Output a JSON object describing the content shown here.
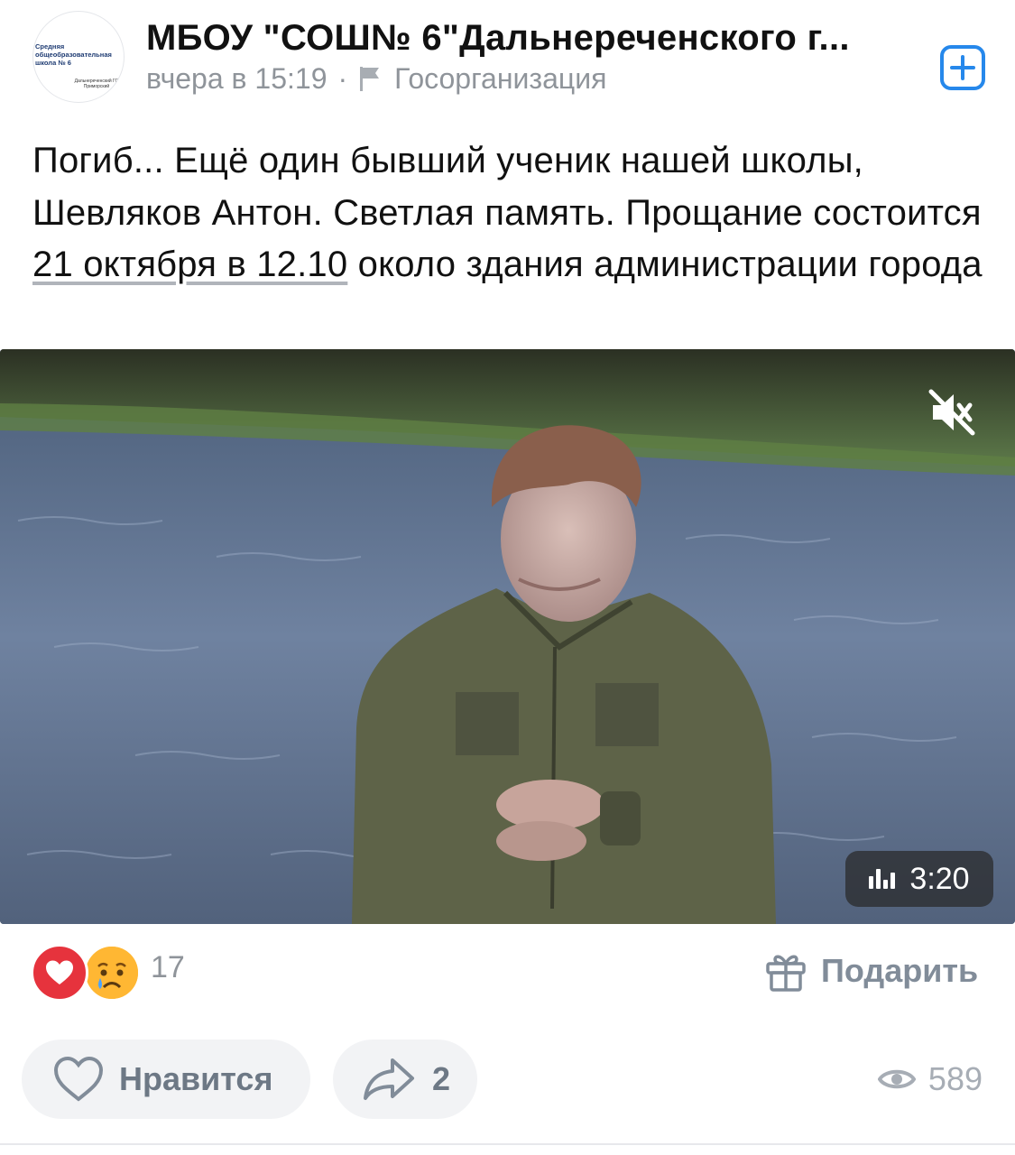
{
  "post": {
    "author": {
      "name": "МБОУ \"СОШ№ 6\"Дальнереченского г...",
      "avatar_line1": "Средняя общеобразовательная школа № 6",
      "avatar_line2": "Дальнереченский ГО Приморский"
    },
    "time": "вчера в 15:19",
    "separator": "·",
    "org_type": "Госорганизация",
    "text": {
      "part1": "Погиб... Ещё один бывший ученик нашей школы, Шевляков Антон. Светлая память. Прощание состоится ",
      "date_link": "21 октября в 12.10",
      "part2": " около здания администрации города"
    },
    "video": {
      "duration": "3:20",
      "muted": true
    }
  },
  "reactions": {
    "count": "17",
    "icons": [
      "heart-reaction",
      "crying-reaction"
    ]
  },
  "gift": {
    "label": "Подарить"
  },
  "actions": {
    "like_label": "Нравится",
    "share_count": "2",
    "views": "589"
  },
  "colors": {
    "accent": "#2688eb",
    "heart": "#e6333d",
    "secondary_text": "#8f949a",
    "pill_bg": "#f2f3f5"
  }
}
